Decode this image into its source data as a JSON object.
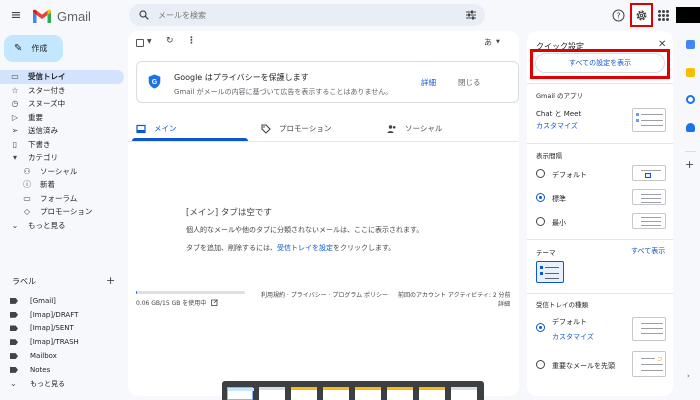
{
  "app": {
    "name": "Gmail"
  },
  "search": {
    "placeholder": "メールを検索"
  },
  "compose": {
    "label": "作成"
  },
  "nav": [
    {
      "label": "受信トレイ",
      "icon": "inbox-icon",
      "active": true
    },
    {
      "label": "スター付き",
      "icon": "star-icon"
    },
    {
      "label": "スヌーズ中",
      "icon": "clock-icon"
    },
    {
      "label": "重要",
      "icon": "important-icon"
    },
    {
      "label": "送信済み",
      "icon": "send-icon"
    },
    {
      "label": "下書き",
      "icon": "draft-icon"
    },
    {
      "label": "カテゴリ",
      "icon": "category-icon"
    },
    {
      "label": "ソーシャル",
      "icon": "people-icon",
      "sub": true
    },
    {
      "label": "新着",
      "icon": "info-icon",
      "sub": true
    },
    {
      "label": "フォーラム",
      "icon": "forum-icon",
      "sub": true
    },
    {
      "label": "プロモーション",
      "icon": "tag-icon",
      "sub": true
    },
    {
      "label": "もっと見る",
      "icon": "chevron-down-icon"
    }
  ],
  "labels": {
    "heading": "ラベル",
    "items": [
      "[Gmail]",
      "[Imap]/DRAFT",
      "[Imap]/SENT",
      "[Imap]/TRASH",
      "Mailbox",
      "Notes",
      "もっと見る"
    ]
  },
  "toolbar": {
    "language": "あ"
  },
  "privacy": {
    "title": "Google はプライバシーを保護します",
    "body": "Gmail がメールの内容に基づいて広告を表示することはありません。",
    "details": "詳細",
    "close": "閉じる"
  },
  "tabs": [
    {
      "label": "メイン",
      "active": true
    },
    {
      "label": "プロモーション"
    },
    {
      "label": "ソーシャル"
    }
  ],
  "empty": {
    "title": "[メイン] タブは空です",
    "line1": "個人的なメールや他のタブに分類されないメールは、ここに表示されます。",
    "line2_prefix": "タブを追加、削除するには、",
    "line2_link": "受信トレイを設定",
    "line2_suffix": "をクリックします。"
  },
  "footer": {
    "storage": "0.06 GB/15 GB を使用中",
    "storage_fraction": 0.004,
    "links": "利用規約 · プライバシー · プログラム ポリシー",
    "activity": "前回のアカウント アクティビティ: 2 分前",
    "details": "詳細"
  },
  "quick_settings": {
    "title": "クイック設定",
    "all_settings_button": "すべての設定を表示",
    "apps_heading": "Gmail のアプリ",
    "apps_label": "Chat と Meet",
    "apps_customize": "カスタマイズ",
    "density_heading": "表示間隔",
    "density_options": [
      "デフォルト",
      "標準",
      "最小"
    ],
    "density_selected": "標準",
    "theme_heading": "テーマ",
    "theme_all": "すべて表示",
    "inbox_heading": "受信トレイの種類",
    "inbox_default": "デフォルト",
    "inbox_customize": "カスタマイズ",
    "inbox_important": "重要なメールを先頭"
  },
  "colors": {
    "accent": "#0b57d0",
    "highlight": "#e00000",
    "compose_bg": "#c2e7ff",
    "nav_active": "#d3e3fd"
  }
}
